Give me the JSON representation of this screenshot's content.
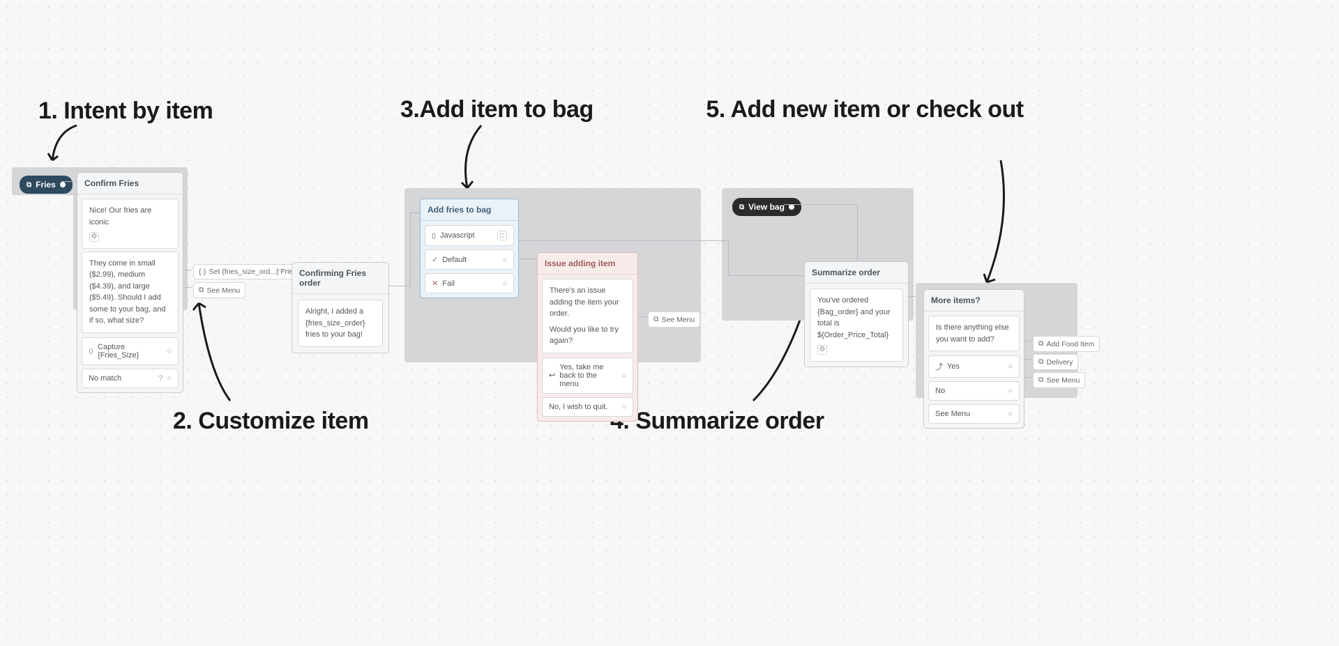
{
  "annotations": {
    "a1": "1. Intent by item",
    "a2": "2. Customize item",
    "a3": "3.Add item to bag",
    "a4": "4. Summarize order",
    "a5": "5. Add new item or check out"
  },
  "pills": {
    "fries": "Fries",
    "viewbag": "View bag"
  },
  "cards": {
    "confirm_fries": {
      "title": "Confirm Fries",
      "line1": "Nice! Our fries are iconic",
      "line2": "They come in small ($2.99), medium ($4.39), and large ($5.49). Should I add some to your bag, and if so, what size?",
      "capture": "Capture {Fries_Size}",
      "nomatch": "No match"
    },
    "set_chip": "Set {fries_size_ord...{ Fries_Size }",
    "see_menu_chip": "See Menu",
    "confirming": {
      "title": "Confirming Fries order",
      "body": "Alright, I added a {fries_size_order} fries to your bag!"
    },
    "add_bag": {
      "title": "Add fries to bag",
      "r1": "Javascript",
      "r2": "Default",
      "r3": "Fail"
    },
    "issue": {
      "title": "Issue adding item",
      "body1": "There's an issue adding the item your order.",
      "body2": "Would you like to try again?",
      "opt1": "Yes, take me back to the menu",
      "opt2": "No, I wish to quit."
    },
    "summarize": {
      "title": "Summarize order",
      "body": "You've ordered {Bag_order} and your total is ${Order_Price_Total}"
    },
    "more": {
      "title": "More items?",
      "body": "Is there anything else you want to add?",
      "r1": "Yes",
      "r2": "No",
      "r3": "See Menu"
    },
    "tags": {
      "add_food": "Add Food Item",
      "delivery": "Delivery",
      "see_menu": "See Menu"
    }
  }
}
